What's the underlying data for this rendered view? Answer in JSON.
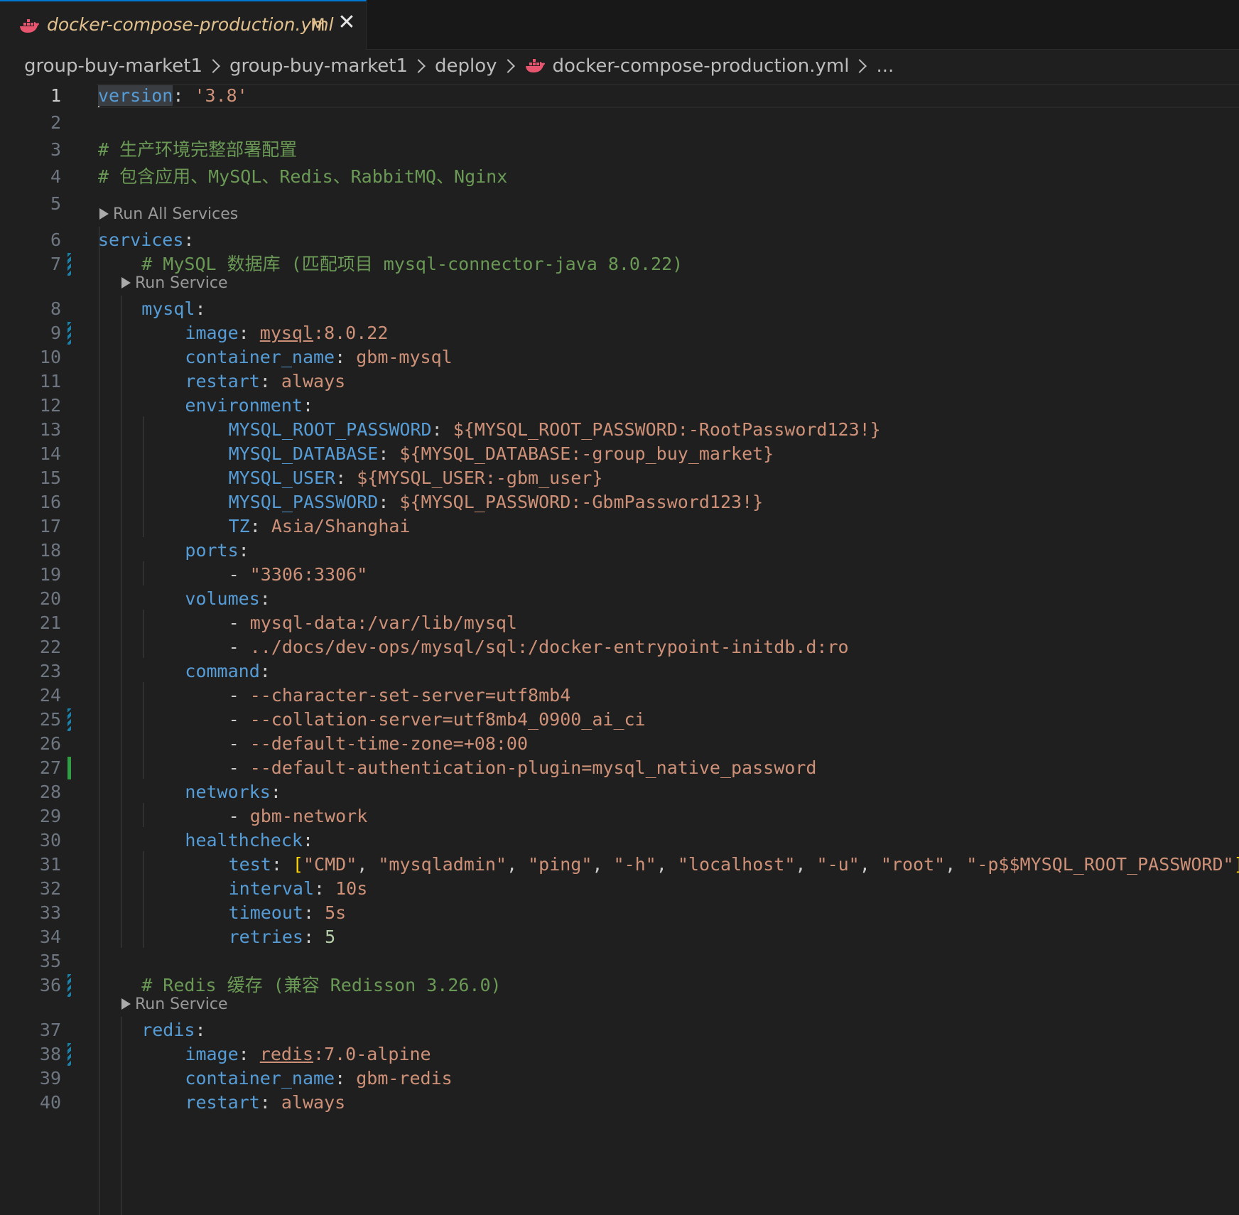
{
  "tab": {
    "title": "docker-compose-production.yml",
    "badge": "M",
    "icon": "docker-whale-icon",
    "accent": "#0078d4"
  },
  "breadcrumb": {
    "items": [
      "group-buy-market1",
      "group-buy-market1",
      "deploy",
      "docker-compose-production.yml",
      "..."
    ]
  },
  "codelens": {
    "run_all": "Run All Services",
    "run_service": "Run Service"
  },
  "colors": {
    "background": "#1f1f1f",
    "key": "#569cd6",
    "string": "#ce9178",
    "comment": "#6a9955",
    "number": "#b5cea8",
    "bracket": "#ffd700",
    "tab_title": "#e2c08d"
  },
  "editor": {
    "active_line": 1,
    "lines": [
      {
        "n": "1",
        "t": [
          [
            "k",
            "version"
          ],
          [
            "p",
            ": "
          ],
          [
            "s",
            "'3.8'"
          ]
        ]
      },
      {
        "n": "2",
        "t": []
      },
      {
        "n": "3",
        "t": [
          [
            "c",
            "# 生产环境完整部署配置"
          ]
        ]
      },
      {
        "n": "4",
        "t": [
          [
            "c",
            "# 包含应用、MySQL、Redis、RabbitMQ、Nginx"
          ]
        ]
      },
      {
        "n": "5",
        "t": []
      },
      {
        "n": "6",
        "t": [
          [
            "k",
            "services"
          ],
          [
            "p",
            ":"
          ]
        ]
      },
      {
        "n": "7",
        "t": [
          [
            "c",
            "# MySQL 数据库 (匹配项目 mysql-connector-java 8.0.22)"
          ]
        ]
      },
      {
        "n": "8",
        "t": [
          [
            "k",
            "mysql"
          ],
          [
            "p",
            ":"
          ]
        ]
      },
      {
        "n": "9",
        "t": [
          [
            "k",
            "image"
          ],
          [
            "p",
            ": "
          ],
          [
            "su",
            "mysql"
          ],
          [
            "s",
            ":8.0.22"
          ]
        ]
      },
      {
        "n": "10",
        "t": [
          [
            "k",
            "container_name"
          ],
          [
            "p",
            ": "
          ],
          [
            "s",
            "gbm-mysql"
          ]
        ]
      },
      {
        "n": "11",
        "t": [
          [
            "k",
            "restart"
          ],
          [
            "p",
            ": "
          ],
          [
            "s",
            "always"
          ]
        ]
      },
      {
        "n": "12",
        "t": [
          [
            "k",
            "environment"
          ],
          [
            "p",
            ":"
          ]
        ]
      },
      {
        "n": "13",
        "t": [
          [
            "k",
            "MYSQL_ROOT_PASSWORD"
          ],
          [
            "p",
            ": "
          ],
          [
            "s",
            "${MYSQL_ROOT_PASSWORD:-RootPassword123!}"
          ]
        ]
      },
      {
        "n": "14",
        "t": [
          [
            "k",
            "MYSQL_DATABASE"
          ],
          [
            "p",
            ": "
          ],
          [
            "s",
            "${MYSQL_DATABASE:-group_buy_market}"
          ]
        ]
      },
      {
        "n": "15",
        "t": [
          [
            "k",
            "MYSQL_USER"
          ],
          [
            "p",
            ": "
          ],
          [
            "s",
            "${MYSQL_USER:-gbm_user}"
          ]
        ]
      },
      {
        "n": "16",
        "t": [
          [
            "k",
            "MYSQL_PASSWORD"
          ],
          [
            "p",
            ": "
          ],
          [
            "s",
            "${MYSQL_PASSWORD:-GbmPassword123!}"
          ]
        ]
      },
      {
        "n": "17",
        "t": [
          [
            "k",
            "TZ"
          ],
          [
            "p",
            ": "
          ],
          [
            "s",
            "Asia/Shanghai"
          ]
        ]
      },
      {
        "n": "18",
        "t": [
          [
            "k",
            "ports"
          ],
          [
            "p",
            ":"
          ]
        ]
      },
      {
        "n": "19",
        "t": [
          [
            "p",
            "- "
          ],
          [
            "s",
            "\"3306:3306\""
          ]
        ]
      },
      {
        "n": "20",
        "t": [
          [
            "k",
            "volumes"
          ],
          [
            "p",
            ":"
          ]
        ]
      },
      {
        "n": "21",
        "t": [
          [
            "p",
            "- "
          ],
          [
            "s",
            "mysql-data:/var/lib/mysql"
          ]
        ]
      },
      {
        "n": "22",
        "t": [
          [
            "p",
            "- "
          ],
          [
            "s",
            "../docs/dev-ops/mysql/sql:/docker-entrypoint-initdb.d:ro"
          ]
        ]
      },
      {
        "n": "23",
        "t": [
          [
            "k",
            "command"
          ],
          [
            "p",
            ":"
          ]
        ]
      },
      {
        "n": "24",
        "t": [
          [
            "p",
            "- "
          ],
          [
            "s",
            "--character-set-server=utf8mb4"
          ]
        ]
      },
      {
        "n": "25",
        "t": [
          [
            "p",
            "- "
          ],
          [
            "s",
            "--collation-server=utf8mb4_0900_ai_ci"
          ]
        ]
      },
      {
        "n": "26",
        "t": [
          [
            "p",
            "- "
          ],
          [
            "s",
            "--default-time-zone=+08:00"
          ]
        ]
      },
      {
        "n": "27",
        "t": [
          [
            "p",
            "- "
          ],
          [
            "s",
            "--default-authentication-plugin=mysql_native_password"
          ]
        ]
      },
      {
        "n": "28",
        "t": [
          [
            "k",
            "networks"
          ],
          [
            "p",
            ":"
          ]
        ]
      },
      {
        "n": "29",
        "t": [
          [
            "p",
            "- "
          ],
          [
            "s",
            "gbm-network"
          ]
        ]
      },
      {
        "n": "30",
        "t": [
          [
            "k",
            "healthcheck"
          ],
          [
            "p",
            ":"
          ]
        ]
      },
      {
        "n": "31",
        "t": [
          [
            "k",
            "test"
          ],
          [
            "p",
            ": "
          ],
          [
            "br",
            "["
          ],
          [
            "s",
            "\"CMD\""
          ],
          [
            "p",
            ", "
          ],
          [
            "s",
            "\"mysqladmin\""
          ],
          [
            "p",
            ", "
          ],
          [
            "s",
            "\"ping\""
          ],
          [
            "p",
            ", "
          ],
          [
            "s",
            "\"-h\""
          ],
          [
            "p",
            ", "
          ],
          [
            "s",
            "\"localhost\""
          ],
          [
            "p",
            ", "
          ],
          [
            "s",
            "\"-u\""
          ],
          [
            "p",
            ", "
          ],
          [
            "s",
            "\"root\""
          ],
          [
            "p",
            ", "
          ],
          [
            "s",
            "\"-p$$MYSQL_ROOT_PASSWORD\""
          ],
          [
            "br",
            "]"
          ]
        ]
      },
      {
        "n": "32",
        "t": [
          [
            "k",
            "interval"
          ],
          [
            "p",
            ": "
          ],
          [
            "s",
            "10s"
          ]
        ]
      },
      {
        "n": "33",
        "t": [
          [
            "k",
            "timeout"
          ],
          [
            "p",
            ": "
          ],
          [
            "s",
            "5s"
          ]
        ]
      },
      {
        "n": "34",
        "t": [
          [
            "k",
            "retries"
          ],
          [
            "p",
            ": "
          ],
          [
            "n",
            "5"
          ]
        ]
      },
      {
        "n": "35",
        "t": []
      },
      {
        "n": "36",
        "t": [
          [
            "c",
            "# Redis 缓存 (兼容 Redisson 3.26.0)"
          ]
        ]
      },
      {
        "n": "37",
        "t": [
          [
            "k",
            "redis"
          ],
          [
            "p",
            ":"
          ]
        ]
      },
      {
        "n": "38",
        "t": [
          [
            "k",
            "image"
          ],
          [
            "p",
            ": "
          ],
          [
            "su",
            "redis"
          ],
          [
            "s",
            ":7.0-alpine"
          ]
        ]
      },
      {
        "n": "39",
        "t": [
          [
            "k",
            "container_name"
          ],
          [
            "p",
            ": "
          ],
          [
            "s",
            "gbm-redis"
          ]
        ]
      },
      {
        "n": "40",
        "t": [
          [
            "k",
            "restart"
          ],
          [
            "p",
            ": "
          ],
          [
            "s",
            "always"
          ]
        ]
      }
    ]
  }
}
